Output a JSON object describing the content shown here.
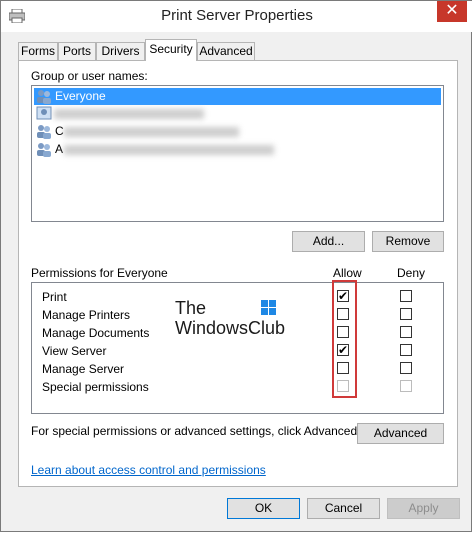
{
  "window": {
    "title": "Print Server Properties",
    "close_glyph": "✕"
  },
  "tabs": [
    {
      "label": "Forms"
    },
    {
      "label": "Ports"
    },
    {
      "label": "Drivers"
    },
    {
      "label": "Security",
      "active": true
    },
    {
      "label": "Advanced"
    }
  ],
  "groups": {
    "label": "Group or user names:",
    "items": [
      {
        "name": "Everyone",
        "selected": true
      },
      {
        "name": "C"
      },
      {
        "name": "A"
      }
    ]
  },
  "buttons": {
    "add": "Add...",
    "remove": "Remove",
    "advanced": "Advanced",
    "ok": "OK",
    "cancel": "Cancel",
    "apply": "Apply"
  },
  "permissions": {
    "label": "Permissions for Everyone",
    "allow_header": "Allow",
    "deny_header": "Deny",
    "rows": [
      {
        "name": "Print",
        "allow": true,
        "deny": false
      },
      {
        "name": "Manage Printers",
        "allow": false,
        "deny": false
      },
      {
        "name": "Manage Documents",
        "allow": false,
        "deny": false
      },
      {
        "name": "View Server",
        "allow": true,
        "deny": false
      },
      {
        "name": "Manage Server",
        "allow": false,
        "deny": false
      },
      {
        "name": "Special permissions",
        "allow": false,
        "deny": false,
        "disabled": true
      }
    ]
  },
  "special_text": "For special permissions or advanced settings, click Advanced.",
  "learn_link": "Learn about access control and permissions",
  "watermark": {
    "line1": "The",
    "line2": "WindowsClub"
  },
  "colors": {
    "selection": "#3399ff",
    "highlight_box": "#d03a3a",
    "close_button": "#c7372a",
    "link": "#0066cc"
  }
}
